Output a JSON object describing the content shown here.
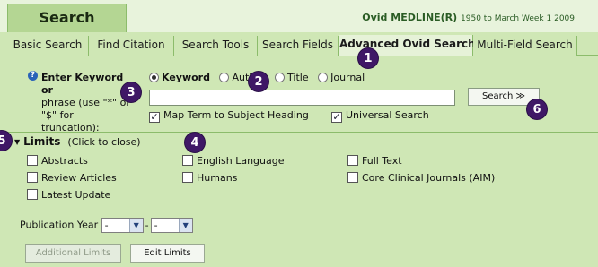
{
  "header": {
    "title": "Search",
    "database": "Ovid MEDLINE(R)",
    "range": "1950 to March Week 1 2009"
  },
  "tabs": [
    {
      "label": "Basic Search"
    },
    {
      "label": "Find Citation"
    },
    {
      "label": "Search Tools"
    },
    {
      "label": "Search Fields"
    },
    {
      "label": "Advanced Ovid Search"
    },
    {
      "label": "Multi-Field Search"
    }
  ],
  "search": {
    "help_icon": "question-icon",
    "prompt_line1": "Enter Keyword or",
    "prompt_line2": "phrase (use \"*\" or",
    "prompt_line3": "\"$\" for",
    "prompt_line4": "truncation):",
    "radio_options": [
      {
        "label": "Keyword",
        "checked": true
      },
      {
        "label": "Author",
        "checked": false
      },
      {
        "label": "Title",
        "checked": false
      },
      {
        "label": "Journal",
        "checked": false
      }
    ],
    "input_value": "",
    "button_label": "Search ≫",
    "map_term_label": "Map Term to Subject Heading",
    "map_term_checked": true,
    "universal_label": "Universal Search",
    "universal_checked": true
  },
  "limits": {
    "title": "Limits",
    "hint": "(Click to close)",
    "items": [
      {
        "label": "Abstracts",
        "checked": false
      },
      {
        "label": "English Language",
        "checked": false
      },
      {
        "label": "Full Text",
        "checked": false
      },
      {
        "label": "Review Articles",
        "checked": false
      },
      {
        "label": "Humans",
        "checked": false
      },
      {
        "label": "Core Clinical Journals (AIM)",
        "checked": false
      },
      {
        "label": "Latest Update",
        "checked": false
      }
    ],
    "pub_year_label": "Publication Year",
    "pub_year_from": "-",
    "pub_year_to": "-",
    "pub_year_separator": "-",
    "additional_limits_label": "Additional Limits",
    "edit_limits_label": "Edit Limits"
  },
  "callouts": [
    "1",
    "2",
    "3",
    "4",
    "5",
    "6"
  ],
  "colors": {
    "panel": "#cfe7b5",
    "border": "#8cbc6b",
    "badge": "#3f1866",
    "db_text": "#2a5c24"
  }
}
